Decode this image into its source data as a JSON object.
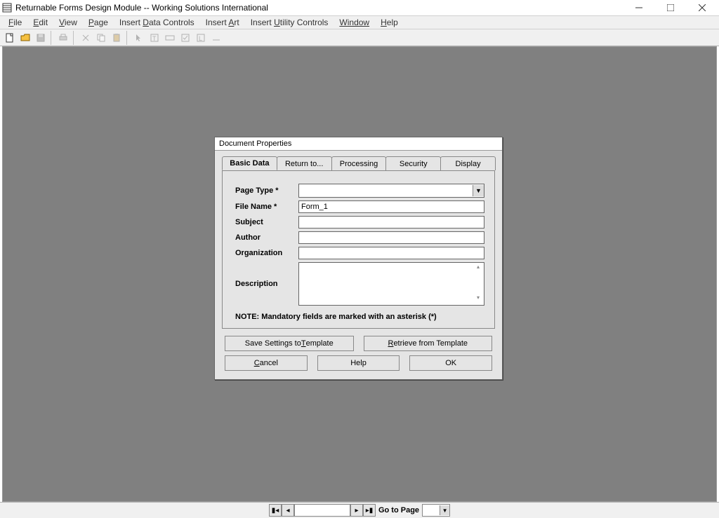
{
  "window": {
    "title": "Returnable Forms Design Module -- Working Solutions International"
  },
  "menu": {
    "file": "File",
    "edit": "Edit",
    "view": "View",
    "page": "Page",
    "insert_data": "Insert Data Controls",
    "insert_art": "Insert Art",
    "insert_utility": "Insert Utility Controls",
    "window": "Window",
    "help": "Help"
  },
  "statusbar": {
    "goto": "Go to Page"
  },
  "dialog": {
    "title": "Document Properties",
    "tabs": {
      "basic": "Basic Data",
      "return": "Return to...",
      "processing": "Processing",
      "security": "Security",
      "display": "Display"
    },
    "labels": {
      "page_type": "Page Type *",
      "file_name": "File Name *",
      "subject": "Subject",
      "author": "Author",
      "organization": "Organization",
      "description": "Description"
    },
    "values": {
      "file_name": "Form_1"
    },
    "note": "NOTE: Mandatory fields are marked with an asterisk (*)",
    "buttons": {
      "save_template_pre": "Save Settings to ",
      "save_template_u": "T",
      "save_template_post": "emplate",
      "retrieve_u": "R",
      "retrieve_post": "etrieve from Template",
      "cancel_u": "C",
      "cancel_post": "ancel",
      "help": "Help",
      "ok": "OK"
    }
  }
}
